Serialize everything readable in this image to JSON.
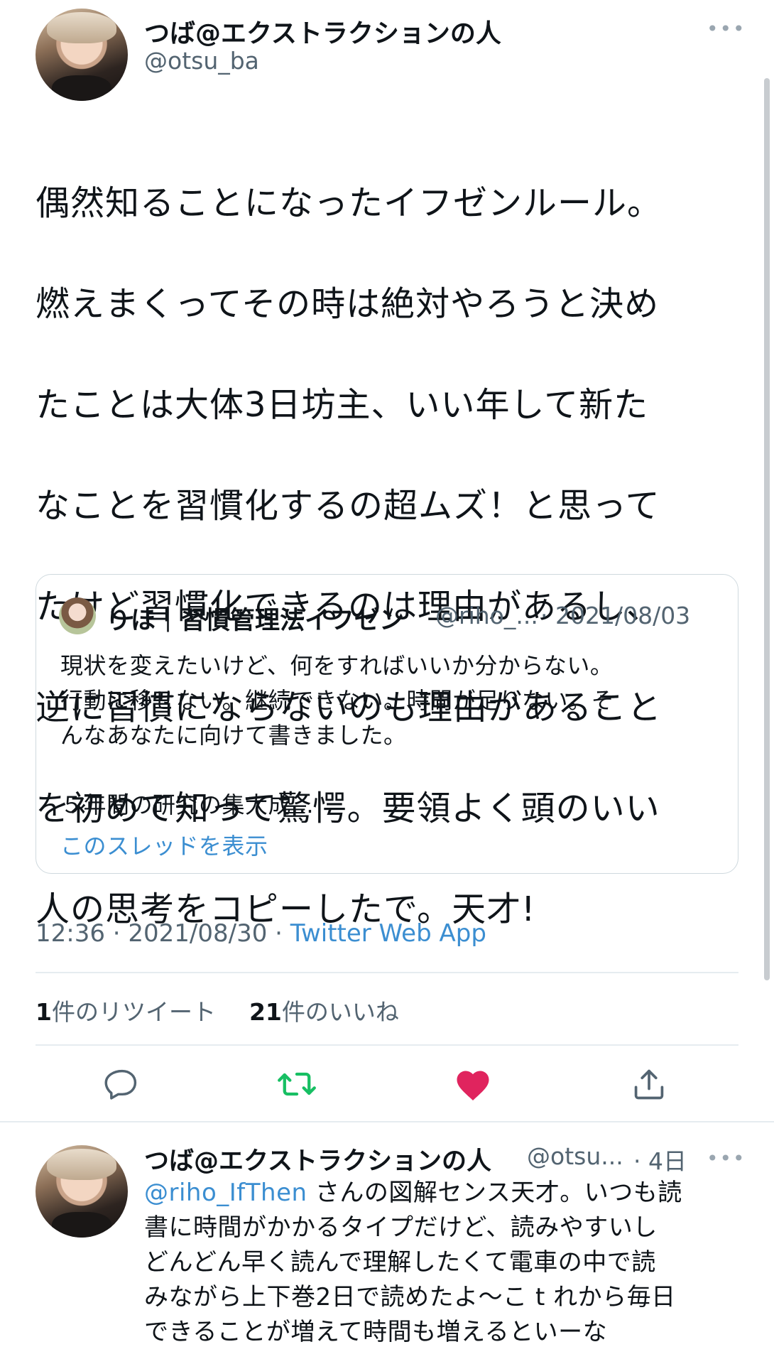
{
  "tweet": {
    "author_name": "つば@エクストラクションの人",
    "author_handle": "@otsu_ba",
    "more_icon": "ellipsis-icon",
    "text_lines": [
      "偶然知ることになったイフゼンルール。",
      "燃えまくってその時は絶対やろうと決め",
      "たことは大体3日坊主、いい年して新た",
      "なことを習慣化するの超ムズ！と思って",
      "たけど習慣化できるのは理由があるし、",
      "逆に習慣にならないのも理由があること",
      "を初めて知って驚愕。要領よく頭のいい",
      "人の思考をコピーしたで。天才!"
    ],
    "quote": {
      "name": "りほ｜習慣管理法イフゼン",
      "handle": "@riho_...",
      "date": "· 2021/08/03",
      "text_lines": [
        "現状を変えたいけど、何をすればいいか分からない。",
        "行動に移せない。継続できない。時間が足りない。そ",
        "んなあなたに向けて書きました。",
        "",
        "５年間の研究の集大成..."
      ],
      "thread_link": "このスレッドを表示"
    },
    "time": "12:36 · 2021/08/30 · ",
    "source": "Twitter Web App",
    "retweet_count": "1",
    "retweet_label": "件のリツイート",
    "like_count": "21",
    "like_label": "件のいいね",
    "colors": {
      "like": "#e0245e",
      "retweet": "#17bf63",
      "link": "#3b8ed1"
    }
  },
  "actions": [
    "reply-icon",
    "retweet-icon",
    "like-icon",
    "share-icon"
  ],
  "reply": {
    "author_name": "つば@エクストラクションの人",
    "author_handle": "@otsu...",
    "time": "· 4日",
    "mention": "@riho_IfThen",
    "text_lines": [
      " さんの図解センス天才。いつも読",
      "書に時間がかかるタイプだけど、読みやすいし",
      "どんどん早く読んで理解したくて電車の中で読",
      "みながら上下巻2日で読めたよ〜こ t れから毎日",
      "できることが増えて時間も増えるといーな"
    ]
  }
}
